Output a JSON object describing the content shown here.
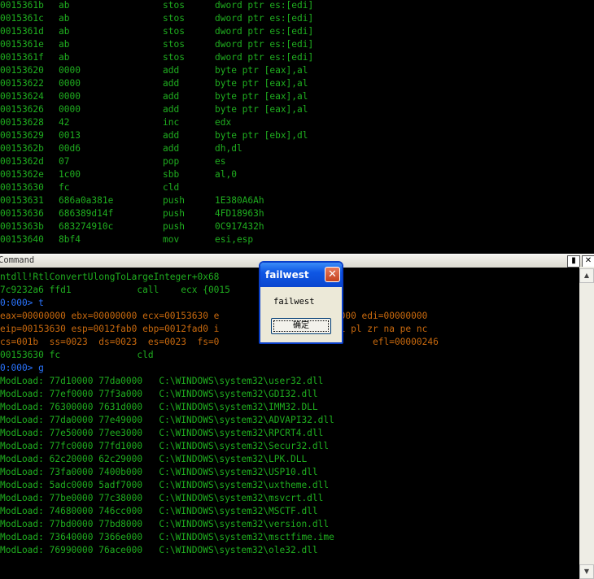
{
  "disassembly": [
    {
      "addr": "0015361b",
      "bytes": "ab",
      "op": "stos",
      "args": "dword ptr es:[edi]"
    },
    {
      "addr": "0015361c",
      "bytes": "ab",
      "op": "stos",
      "args": "dword ptr es:[edi]"
    },
    {
      "addr": "0015361d",
      "bytes": "ab",
      "op": "stos",
      "args": "dword ptr es:[edi]"
    },
    {
      "addr": "0015361e",
      "bytes": "ab",
      "op": "stos",
      "args": "dword ptr es:[edi]"
    },
    {
      "addr": "0015361f",
      "bytes": "ab",
      "op": "stos",
      "args": "dword ptr es:[edi]"
    },
    {
      "addr": "00153620",
      "bytes": "0000",
      "op": "add",
      "args": "byte ptr [eax],al"
    },
    {
      "addr": "00153622",
      "bytes": "0000",
      "op": "add",
      "args": "byte ptr [eax],al"
    },
    {
      "addr": "00153624",
      "bytes": "0000",
      "op": "add",
      "args": "byte ptr [eax],al"
    },
    {
      "addr": "00153626",
      "bytes": "0000",
      "op": "add",
      "args": "byte ptr [eax],al"
    },
    {
      "addr": "00153628",
      "bytes": "42",
      "op": "inc",
      "args": "edx"
    },
    {
      "addr": "00153629",
      "bytes": "0013",
      "op": "add",
      "args": "byte ptr [ebx],dl"
    },
    {
      "addr": "0015362b",
      "bytes": "00d6",
      "op": "add",
      "args": "dh,dl"
    },
    {
      "addr": "0015362d",
      "bytes": "07",
      "op": "pop",
      "args": "es"
    },
    {
      "addr": "0015362e",
      "bytes": "1c00",
      "op": "sbb",
      "args": "al,0"
    },
    {
      "addr": "00153630",
      "bytes": "fc",
      "op": "cld",
      "args": ""
    },
    {
      "addr": "00153631",
      "bytes": "686a0a381e",
      "op": "push",
      "args": "1E380A6Ah"
    },
    {
      "addr": "00153636",
      "bytes": "686389d14f",
      "op": "push",
      "args": "4FD18963h"
    },
    {
      "addr": "0015363b",
      "bytes": "683274910c",
      "op": "push",
      "args": "0C917432h"
    },
    {
      "addr": "00153640",
      "bytes": "8bf4",
      "op": "mov",
      "args": "esi,esp"
    }
  ],
  "command_window": {
    "title": "Command",
    "lines": [
      {
        "text": "ntdll!RtlConvertUlongToLargeInteger+0x68",
        "color": "green"
      },
      {
        "text": "7c9232a6 ffd1            call    ecx {0015",
        "color": "green"
      },
      {
        "text": "0:000> t",
        "color": "blue"
      },
      {
        "text": "eax=00000000 ebx=00000000 ecx=00153630 e              si=00000000 edi=00000000",
        "color": "orange"
      },
      {
        "text": "eip=00153630 esp=0012fab0 ebp=0012fad0 i               nv up ei pl zr na pe nc",
        "color": "orange"
      },
      {
        "text": "cs=001b  ss=0023  ds=0023  es=0023  fs=0                            efl=00000246",
        "color": "orange"
      },
      {
        "text": "00153630 fc              cld",
        "color": "green"
      },
      {
        "text": "0:000> g",
        "color": "blue"
      },
      {
        "text": "ModLoad: 77d10000 77da0000   C:\\WINDOWS\\system32\\user32.dll",
        "color": "green"
      },
      {
        "text": "ModLoad: 77ef0000 77f3a000   C:\\WINDOWS\\system32\\GDI32.dll",
        "color": "green"
      },
      {
        "text": "ModLoad: 76300000 7631d000   C:\\WINDOWS\\system32\\IMM32.DLL",
        "color": "green"
      },
      {
        "text": "ModLoad: 77da0000 77e49000   C:\\WINDOWS\\system32\\ADVAPI32.dll",
        "color": "green"
      },
      {
        "text": "ModLoad: 77e50000 77ee3000   C:\\WINDOWS\\system32\\RPCRT4.dll",
        "color": "green"
      },
      {
        "text": "ModLoad: 77fc0000 77fd1000   C:\\WINDOWS\\system32\\Secur32.dll",
        "color": "green"
      },
      {
        "text": "ModLoad: 62c20000 62c29000   C:\\WINDOWS\\system32\\LPK.DLL",
        "color": "green"
      },
      {
        "text": "ModLoad: 73fa0000 7400b000   C:\\WINDOWS\\system32\\USP10.dll",
        "color": "green"
      },
      {
        "text": "ModLoad: 5adc0000 5adf7000   C:\\WINDOWS\\system32\\uxtheme.dll",
        "color": "green"
      },
      {
        "text": "ModLoad: 77be0000 77c38000   C:\\WINDOWS\\system32\\msvcrt.dll",
        "color": "green"
      },
      {
        "text": "ModLoad: 74680000 746cc000   C:\\WINDOWS\\system32\\MSCTF.dll",
        "color": "green"
      },
      {
        "text": "ModLoad: 77bd0000 77bd8000   C:\\WINDOWS\\system32\\version.dll",
        "color": "green"
      },
      {
        "text": "ModLoad: 73640000 7366e000   C:\\WINDOWS\\system32\\msctfime.ime",
        "color": "green"
      },
      {
        "text": "ModLoad: 76990000 76ace000   C:\\WINDOWS\\system32\\ole32.dll",
        "color": "green"
      }
    ]
  },
  "dialog": {
    "title": "failwest",
    "message": "failwest",
    "ok_label": "确定"
  },
  "icons": {
    "command_pin": "pin-icon",
    "command_close": "close-icon",
    "dialog_close": "close-icon",
    "scroll_up": "arrow-up-icon",
    "scroll_down": "arrow-down-icon"
  }
}
